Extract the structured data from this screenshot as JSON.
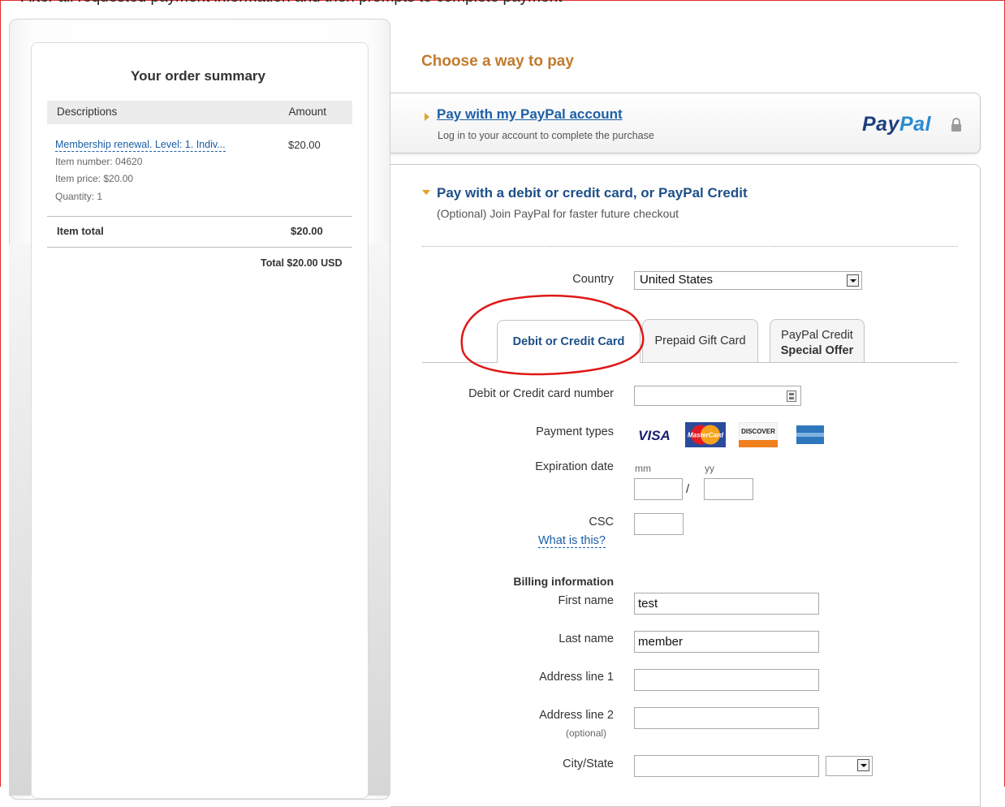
{
  "top_instruction": "After all requested payment information and then prompts to complete payment",
  "order_summary": {
    "title": "Your order summary",
    "col_descriptions": "Descriptions",
    "col_amount": "Amount",
    "item_name": "Membership renewal. Level: 1. Indiv...",
    "item_amount": "$20.00",
    "item_number": "Item number: 04620",
    "item_price": "Item price: $20.00",
    "quantity": "Quantity: 1",
    "item_total_label": "Item total",
    "item_total_value": "$20.00",
    "grand_total": "Total $20.00 USD"
  },
  "choose_title": "Choose a way to pay",
  "paypal_option": {
    "link": "Pay with my PayPal account",
    "subtitle": "Log in to your account to complete the purchase",
    "logo_pay": "Pay",
    "logo_pal": "Pal"
  },
  "card_option": {
    "title": "Pay with a debit or credit card, or PayPal Credit",
    "subtitle": "(Optional) Join PayPal for faster future checkout"
  },
  "form": {
    "country_label": "Country",
    "country_value": "United States",
    "tabs": [
      {
        "label": "Debit or Credit Card"
      },
      {
        "label": "Prepaid Gift Card"
      },
      {
        "label_line1": "PayPal Credit",
        "label_line2": "Special Offer"
      }
    ],
    "card_number_label": "Debit or Credit card number",
    "payment_types_label": "Payment types",
    "card_brands": [
      "VISA",
      "MasterCard",
      "DISCOVER",
      "AMERICAN EXPRESS"
    ],
    "expiration_label": "Expiration date",
    "exp_mm_hint": "mm",
    "exp_yy_hint": "yy",
    "exp_separator": "/",
    "csc_label": "CSC",
    "csc_help_link": "What is this?",
    "billing_header": "Billing information",
    "first_name_label": "First name",
    "first_name_value": "test",
    "last_name_label": "Last name",
    "last_name_value": "member",
    "address1_label": "Address line 1",
    "address2_label": "Address line 2",
    "address2_optional": "(optional)",
    "city_state_label": "City/State"
  },
  "colors": {
    "accent_orange": "#c27b2c",
    "link_blue": "#1d5fa5",
    "annotation_red": "#e01818"
  }
}
